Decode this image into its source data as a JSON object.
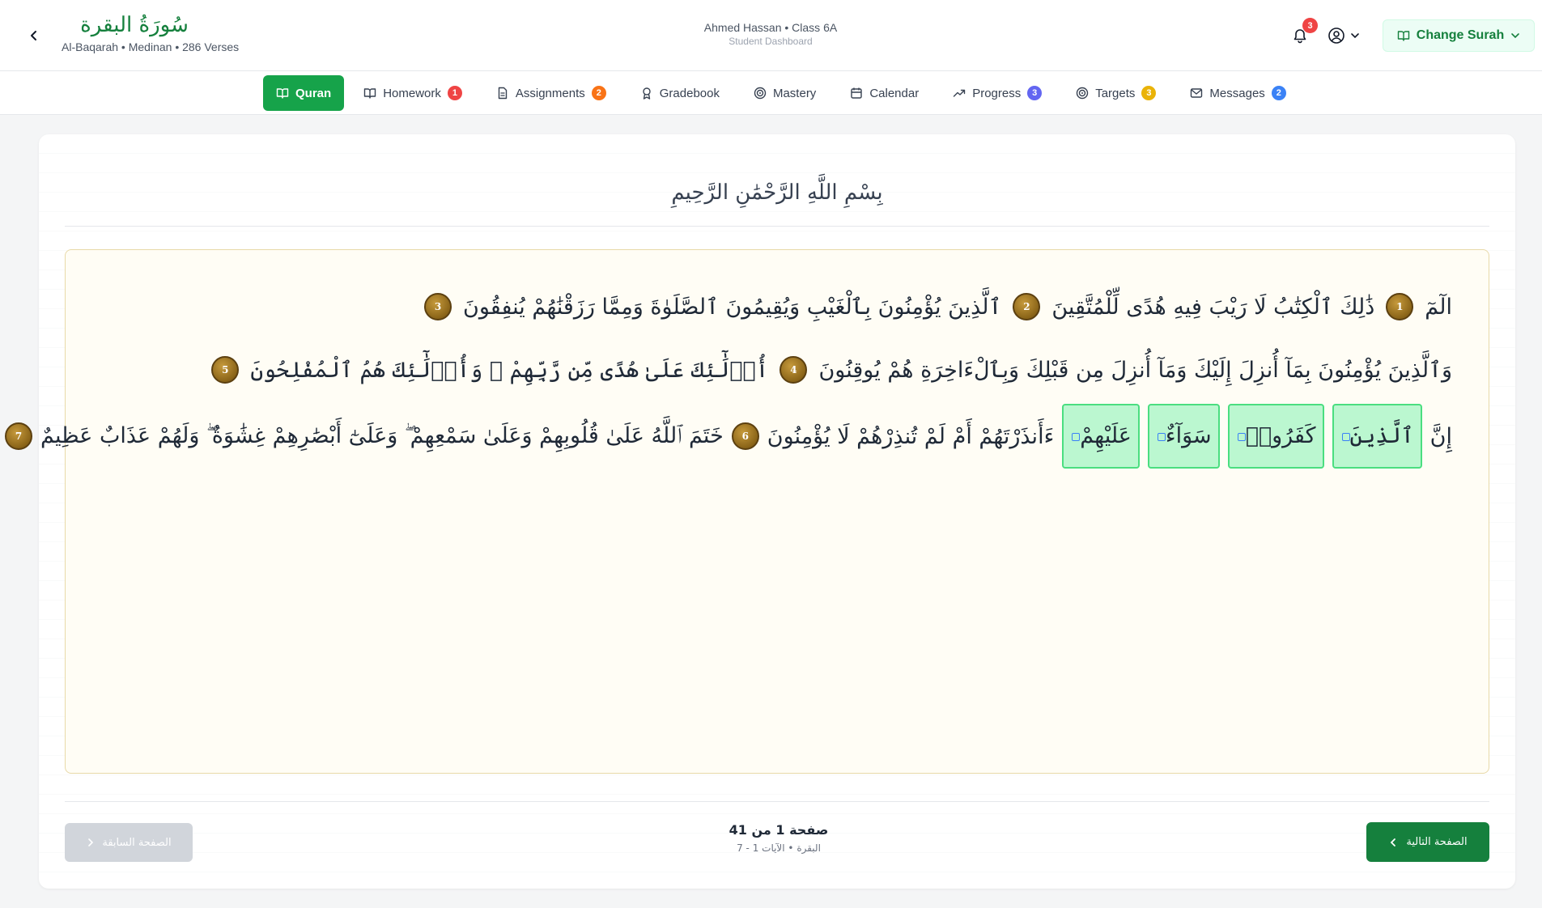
{
  "header": {
    "surah_arabic": "سُورَةُ البقرة",
    "surah_meta": "Al-Baqarah • Medinan • 286 Verses",
    "student_name": "Ahmed Hassan • Class 6A",
    "student_role": "Student Dashboard",
    "notification_count": "3",
    "change_surah_label": "Change Surah",
    "accent_color": "#16a34a"
  },
  "nav": {
    "tabs": [
      {
        "label": "Quran",
        "icon": "book-open-icon",
        "badge": null,
        "active": true
      },
      {
        "label": "Homework",
        "icon": "book-open-icon",
        "badge": "1",
        "badge_color": "#ef4444"
      },
      {
        "label": "Assignments",
        "icon": "document-icon",
        "badge": "2",
        "badge_color": "#f97316"
      },
      {
        "label": "Gradebook",
        "icon": "award-icon",
        "badge": null
      },
      {
        "label": "Mastery",
        "icon": "target-icon",
        "badge": null
      },
      {
        "label": "Calendar",
        "icon": "calendar-icon",
        "badge": null
      },
      {
        "label": "Progress",
        "icon": "trend-icon",
        "badge": "3",
        "badge_color": "#6366f1"
      },
      {
        "label": "Targets",
        "icon": "target-icon",
        "badge": "3",
        "badge_color": "#eab308"
      },
      {
        "label": "Messages",
        "icon": "mail-icon",
        "badge": "2",
        "badge_color": "#3b82f6"
      }
    ]
  },
  "basmala": "بِسْمِ اللَّهِ الرَّحْمَٰنِ الرَّحِيمِ",
  "verses": {
    "line1": {
      "w1": "الٓمٓ",
      "n1": "1",
      "w2": "ذَٰلِكَ ٱلْكِتَٰبُ لَا رَيْبَ فِيهِ هُدًى لِّلْمُتَّقِينَ",
      "n2": "2",
      "w3": "ٱلَّذِينَ يُؤْمِنُونَ بِٱلْغَيْبِ وَيُقِيمُونَ ٱلصَّلَوٰةَ وَمِمَّا رَزَقْنَٰهُمْ يُنفِقُونَ",
      "n3": "3"
    },
    "line2": {
      "w1": "وَٱلَّذِينَ يُؤْمِنُونَ بِمَآ أُنزِلَ إِلَيْكَ وَمَآ أُنزِلَ مِن قَبْلِكَ وَبِٱلْءَاخِرَةِ هُمْ يُوقِنُونَ",
      "n1": "4",
      "w2": "أُو۟لَٰٓئِكَ عَلَىٰ هُدًى مِّن رَّبِّهِمْ ۖ وَأُو۟لَٰٓئِكَ هُمُ ٱلْمُفْلِحُونَ",
      "n2": "5"
    },
    "line3": {
      "w0": "إِنَّ",
      "hl1": "ٱلَّذِينَ",
      "hl2": "كَفَرُوا۟",
      "hl3": "سَوَآءٌ",
      "hl4": "عَلَيْهِمْ",
      "w1": "ءَأَنذَرْتَهُمْ أَمْ لَمْ تُنذِرْهُمْ لَا يُؤْمِنُونَ",
      "n1": "6",
      "w2": "خَتَمَ ٱللَّهُ عَلَىٰ قُلُوبِهِمْ وَعَلَىٰ سَمْعِهِمْ ۖ وَعَلَىٰٓ أَبْصَٰرِهِمْ غِشَٰوَةٌ ۖ وَلَهُمْ عَذَابٌ عَظِيمٌ",
      "n2": "7"
    }
  },
  "pagination": {
    "prev_label": "الصفحة السابقة",
    "next_label": "الصفحة التالية",
    "page_label": "صفحة 1 من 41",
    "page_sub": "البقرة • الآيات 1 - 7"
  }
}
